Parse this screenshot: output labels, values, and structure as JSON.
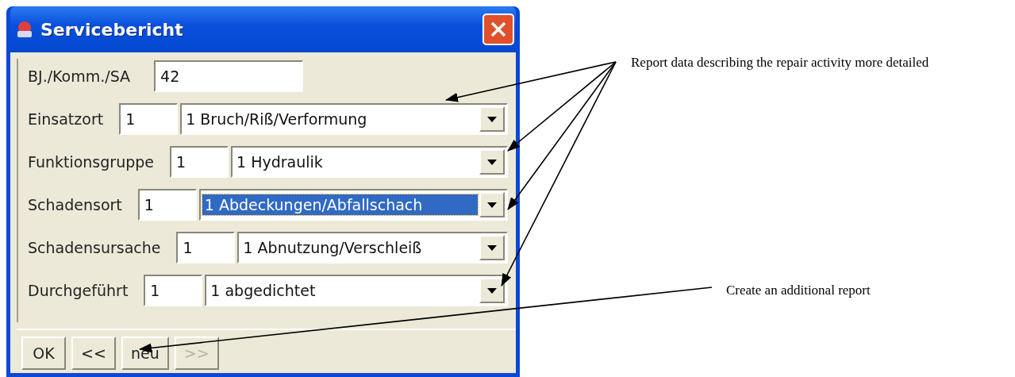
{
  "window": {
    "title": "Servicebericht"
  },
  "project": {
    "label": "BJ./Komm./SA",
    "value": "42"
  },
  "rows": [
    {
      "label": "Einsatzort",
      "code": "1",
      "selection": "1 Bruch/Riß/Verformung",
      "selected": false
    },
    {
      "label": "Funktionsgruppe",
      "code": "1",
      "selection": "1 Hydraulik",
      "selected": false
    },
    {
      "label": "Schadensort",
      "code": "1",
      "selection": "1 Abdeckungen/Abfallschach",
      "selected": true
    },
    {
      "label": "Schadensursache",
      "code": "1",
      "selection": "1 Abnutzung/Verschleiß",
      "selected": false
    },
    {
      "label": "Durchgeführt",
      "code": "1",
      "selection": "1 abgedichtet",
      "selected": false
    }
  ],
  "buttons": [
    {
      "label": "OK",
      "disabled": false
    },
    {
      "label": "<<",
      "disabled": false
    },
    {
      "label": "neu",
      "disabled": false
    },
    {
      "label": ">>",
      "disabled": true
    }
  ],
  "annotations": [
    {
      "text": "Report data describing the repair activity more detailed"
    },
    {
      "text": "Create an additional report"
    }
  ]
}
